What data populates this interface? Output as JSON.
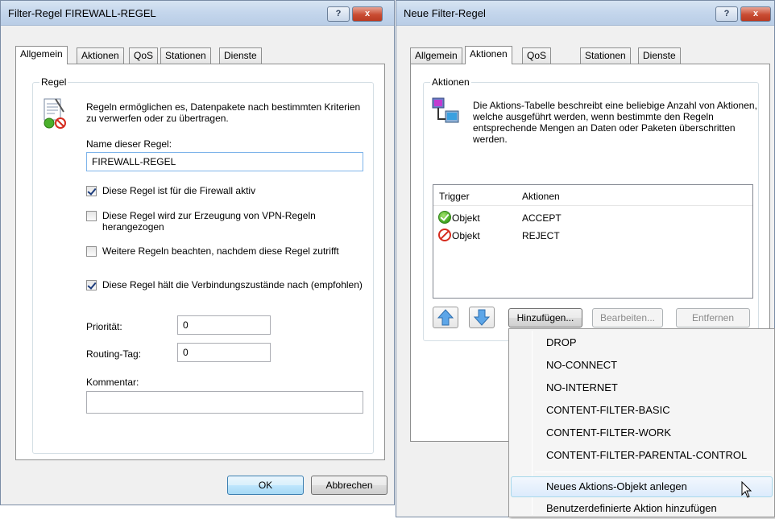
{
  "dialog1": {
    "title": "Filter-Regel FIREWALL-REGEL",
    "help_label": "?",
    "close_label": "x",
    "tabs": [
      {
        "label": "Allgemein"
      },
      {
        "label": "Aktionen"
      },
      {
        "label": "QoS"
      },
      {
        "label": "Stationen"
      },
      {
        "label": "Dienste"
      }
    ],
    "active_tab": "Allgemein",
    "group_title": "Regel",
    "description": "Regeln ermöglichen es, Datenpakete nach bestimmten Kriterien zu verwerfen oder zu übertragen.",
    "name_label": "Name dieser Regel:",
    "name_value": "FIREWALL-REGEL",
    "checkboxes": [
      {
        "label": "Diese Regel ist für die Firewall aktiv",
        "checked": true
      },
      {
        "label": "Diese Regel wird zur Erzeugung von VPN-Regeln herangezogen",
        "checked": false
      },
      {
        "label": "Weitere Regeln beachten, nachdem diese Regel zutrifft",
        "checked": false
      },
      {
        "label": "Diese Regel hält die Verbindungszustände nach (empfohlen)",
        "checked": true
      }
    ],
    "priority_label": "Priorität:",
    "priority_value": "0",
    "routing_label": "Routing-Tag:",
    "routing_value": "0",
    "comment_label": "Kommentar:",
    "comment_value": "",
    "ok_label": "OK",
    "cancel_label": "Abbrechen"
  },
  "dialog2": {
    "title": "Neue Filter-Regel",
    "help_label": "?",
    "close_label": "x",
    "tabs": [
      {
        "label": "Allgemein"
      },
      {
        "label": "Aktionen"
      },
      {
        "label": "QoS"
      },
      {
        "label": "Stationen"
      },
      {
        "label": "Dienste"
      }
    ],
    "active_tab": "Aktionen",
    "group_title": "Aktionen",
    "description": "Die Aktions-Tabelle beschreibt eine beliebige Anzahl von Aktionen, welche ausgeführt werden, wenn bestimmte den Regeln entsprechende Mengen an Daten oder Paketen überschritten werden.",
    "table": {
      "columns": [
        "Trigger",
        "Aktionen"
      ],
      "rows": [
        {
          "status": "ok",
          "trigger": "Objekt",
          "action": "ACCEPT"
        },
        {
          "status": "blocked",
          "trigger": "Objekt",
          "action": "REJECT"
        }
      ]
    },
    "buttons": {
      "add": "Hinzufügen...",
      "edit": "Bearbeiten...",
      "remove": "Entfernen"
    }
  },
  "context_menu": {
    "items": [
      {
        "label": "DROP"
      },
      {
        "label": "NO-CONNECT"
      },
      {
        "label": "NO-INTERNET"
      },
      {
        "label": "CONTENT-FILTER-BASIC"
      },
      {
        "label": "CONTENT-FILTER-WORK"
      },
      {
        "label": "CONTENT-FILTER-PARENTAL-CONTROL"
      },
      {
        "label": "Neues Aktions-Objekt anlegen",
        "highlighted": true
      },
      {
        "label": "Benutzerdefinierte Aktion hinzufügen"
      }
    ]
  }
}
